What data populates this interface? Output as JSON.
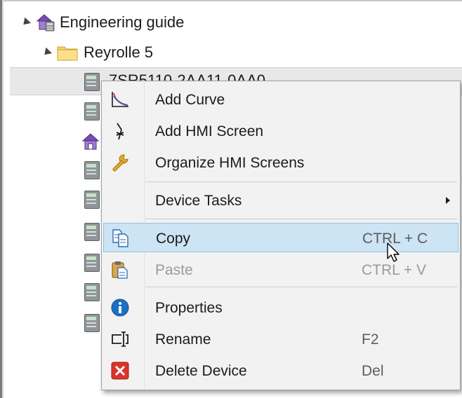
{
  "tree": {
    "root": {
      "label": "Engineering guide",
      "icon": "project-home-icon"
    },
    "folder": {
      "label": "Reyrolle 5",
      "icon": "folder-icon"
    },
    "selected_device": {
      "label": "7SR5110-2AA11-0AA0",
      "icon": "device-icon"
    },
    "child_icons": [
      "device-icon",
      "house-icon",
      "device-icon",
      "device-icon",
      "device-icon",
      "device-icon",
      "device-icon",
      "device-icon"
    ]
  },
  "context_menu": {
    "items": [
      {
        "label": "Add Curve",
        "icon": "curve-chart-icon",
        "shortcut": ""
      },
      {
        "label": "Add HMI Screen",
        "icon": "hmi-cursor-icon",
        "shortcut": ""
      },
      {
        "label": "Organize HMI Screens",
        "icon": "wrench-icon",
        "shortcut": ""
      },
      {
        "label": "Device Tasks",
        "icon": "",
        "shortcut": "",
        "submenu": true
      },
      {
        "label": "Copy",
        "icon": "copy-icon",
        "shortcut": "CTRL + C",
        "highlighted": true
      },
      {
        "label": "Paste",
        "icon": "paste-icon",
        "shortcut": "CTRL + V",
        "disabled": true
      },
      {
        "label": "Properties",
        "icon": "info-icon",
        "shortcut": ""
      },
      {
        "label": "Rename",
        "icon": "rename-icon",
        "shortcut": "F2"
      },
      {
        "label": "Delete Device",
        "icon": "delete-icon",
        "shortcut": "Del"
      }
    ]
  },
  "colors": {
    "highlight": "#cce4f4",
    "highlight_border": "#8fc3e6",
    "menu_bg": "#f2f2f2",
    "delete_red": "#d9342b",
    "info_blue": "#1d6fc4"
  }
}
